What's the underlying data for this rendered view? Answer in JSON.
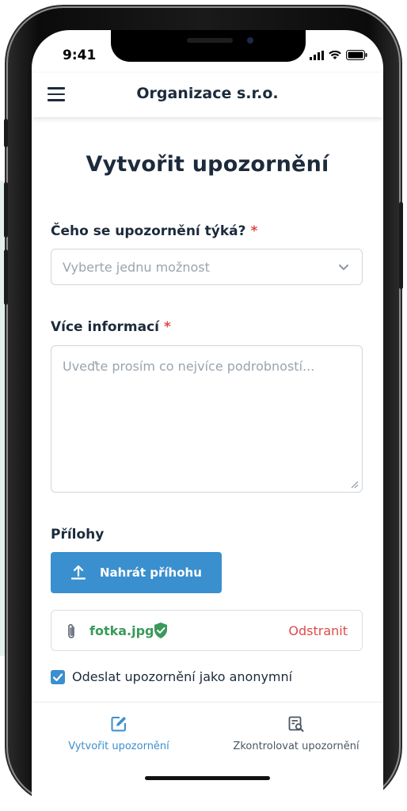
{
  "status_bar": {
    "time": "9:41"
  },
  "header": {
    "title": "Organizace s.r.o."
  },
  "page": {
    "title": "Vytvořit upozornění"
  },
  "form": {
    "topic_label": "Čeho se upozornění týká?",
    "required_mark": "*",
    "topic_placeholder": "Vyberte jednu možnost",
    "details_label": "Více informací",
    "details_placeholder": "Uveďte prosím co nejvíce podrobností...",
    "attachments_label": "Přílohy",
    "upload_label": "Nahrát příhohu",
    "file_name": "fotka.jpg",
    "remove_label": "Odstranit",
    "anonymous_label": "Odeslat upozornění jako anonymní",
    "anonymous_checked": true
  },
  "bottom_nav": {
    "items": [
      {
        "label": "Vytvořit upozornění",
        "icon": "edit-icon",
        "active": true
      },
      {
        "label": "Zkontrolovat upozornění",
        "icon": "review-icon",
        "active": false
      }
    ]
  },
  "colors": {
    "primary": "#3a8fce",
    "text_dark": "#1c2b3c",
    "required": "#e04a4a",
    "success": "#3a9a5a"
  }
}
